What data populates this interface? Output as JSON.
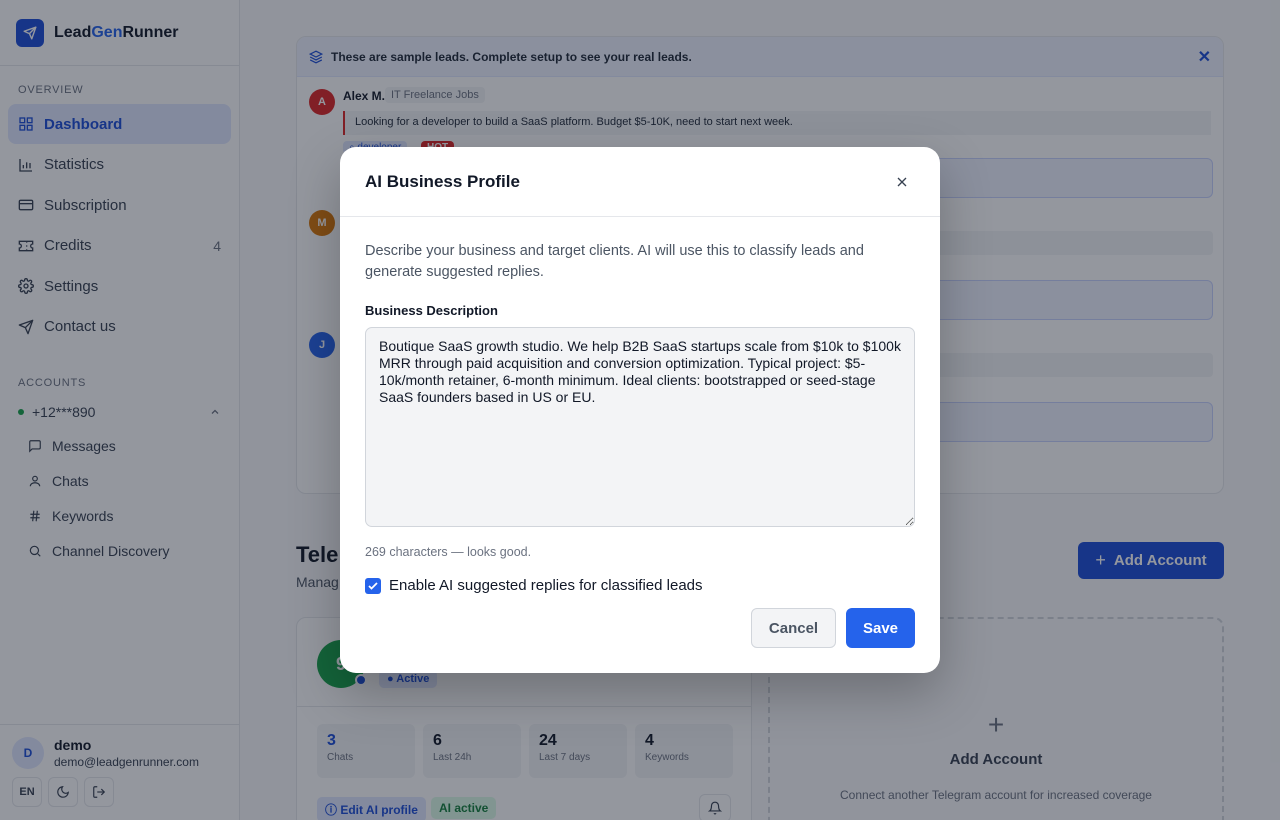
{
  "brand": {
    "prefix": "Lead",
    "accent": "Gen",
    "suffix": "Runner"
  },
  "sidebar": {
    "overview_label": "OVERVIEW",
    "items": [
      {
        "label": "Dashboard",
        "icon": "dashboard-icon",
        "active": true
      },
      {
        "label": "Statistics",
        "icon": "bar-chart-icon"
      },
      {
        "label": "Subscription",
        "icon": "credit-card-icon"
      },
      {
        "label": "Credits",
        "icon": "ticket-icon",
        "count": "4"
      },
      {
        "label": "Settings",
        "icon": "gear-icon"
      },
      {
        "label": "Contact us",
        "icon": "send-icon"
      }
    ],
    "accounts_label": "ACCOUNTS",
    "account_phone": "+12***890",
    "sub_items": [
      {
        "label": "Messages",
        "icon": "message-icon"
      },
      {
        "label": "Chats",
        "icon": "user-icon"
      },
      {
        "label": "Keywords",
        "icon": "hash-icon"
      },
      {
        "label": "Channel Discovery",
        "icon": "search-icon"
      }
    ]
  },
  "user": {
    "initial": "D",
    "name": "demo",
    "email": "demo@leadgenrunner.com",
    "lang": "EN"
  },
  "leads": {
    "banner": "These are sample leads. Complete setup to see your real leads.",
    "first": {
      "initial": "A",
      "name": "Alex M.",
      "chat": "IT Freelance Jobs",
      "message": "Looking for a developer to build a SaaS platform. Budget $5-10K, need to start next week.",
      "tag_keyword": "developer",
      "tag_hot": "HOT"
    },
    "second_initial": "M",
    "third_initial": "J"
  },
  "telegram": {
    "title": "Tele",
    "subtitle": "Manag",
    "add_button": "Add Account",
    "account": {
      "avatar_text": "9",
      "status": "Active",
      "stats": [
        {
          "value": "3",
          "label": "Chats"
        },
        {
          "value": "6",
          "label": "Last 24h"
        },
        {
          "value": "24",
          "label": "Last 7 days"
        },
        {
          "value": "4",
          "label": "Keywords"
        }
      ],
      "edit_ai": "Edit AI profile",
      "ai_active": "AI active"
    },
    "add_card": {
      "title": "Add Account",
      "desc": "Connect another Telegram account for increased coverage"
    }
  },
  "modal": {
    "title": "AI Business Profile",
    "description": "Describe your business and target clients. AI will use this to classify leads and generate suggested replies.",
    "field_label": "Business Description",
    "field_value": "Boutique SaaS growth studio. We help B2B SaaS startups scale from $10k to $100k MRR through paid acquisition and conversion optimization. Typical project: $5-10k/month retainer, 6-month minimum. Ideal clients: bootstrapped or seed-stage SaaS founders based in US or EU.",
    "char_count": "269 characters — looks good.",
    "checkbox_label": "Enable AI suggested replies for classified leads",
    "checkbox_checked": true,
    "cancel": "Cancel",
    "save": "Save"
  },
  "colors": {
    "accent": "#2563eb",
    "brand": "#1d4ed8",
    "success": "#16a34a",
    "danger": "#dc2626"
  }
}
